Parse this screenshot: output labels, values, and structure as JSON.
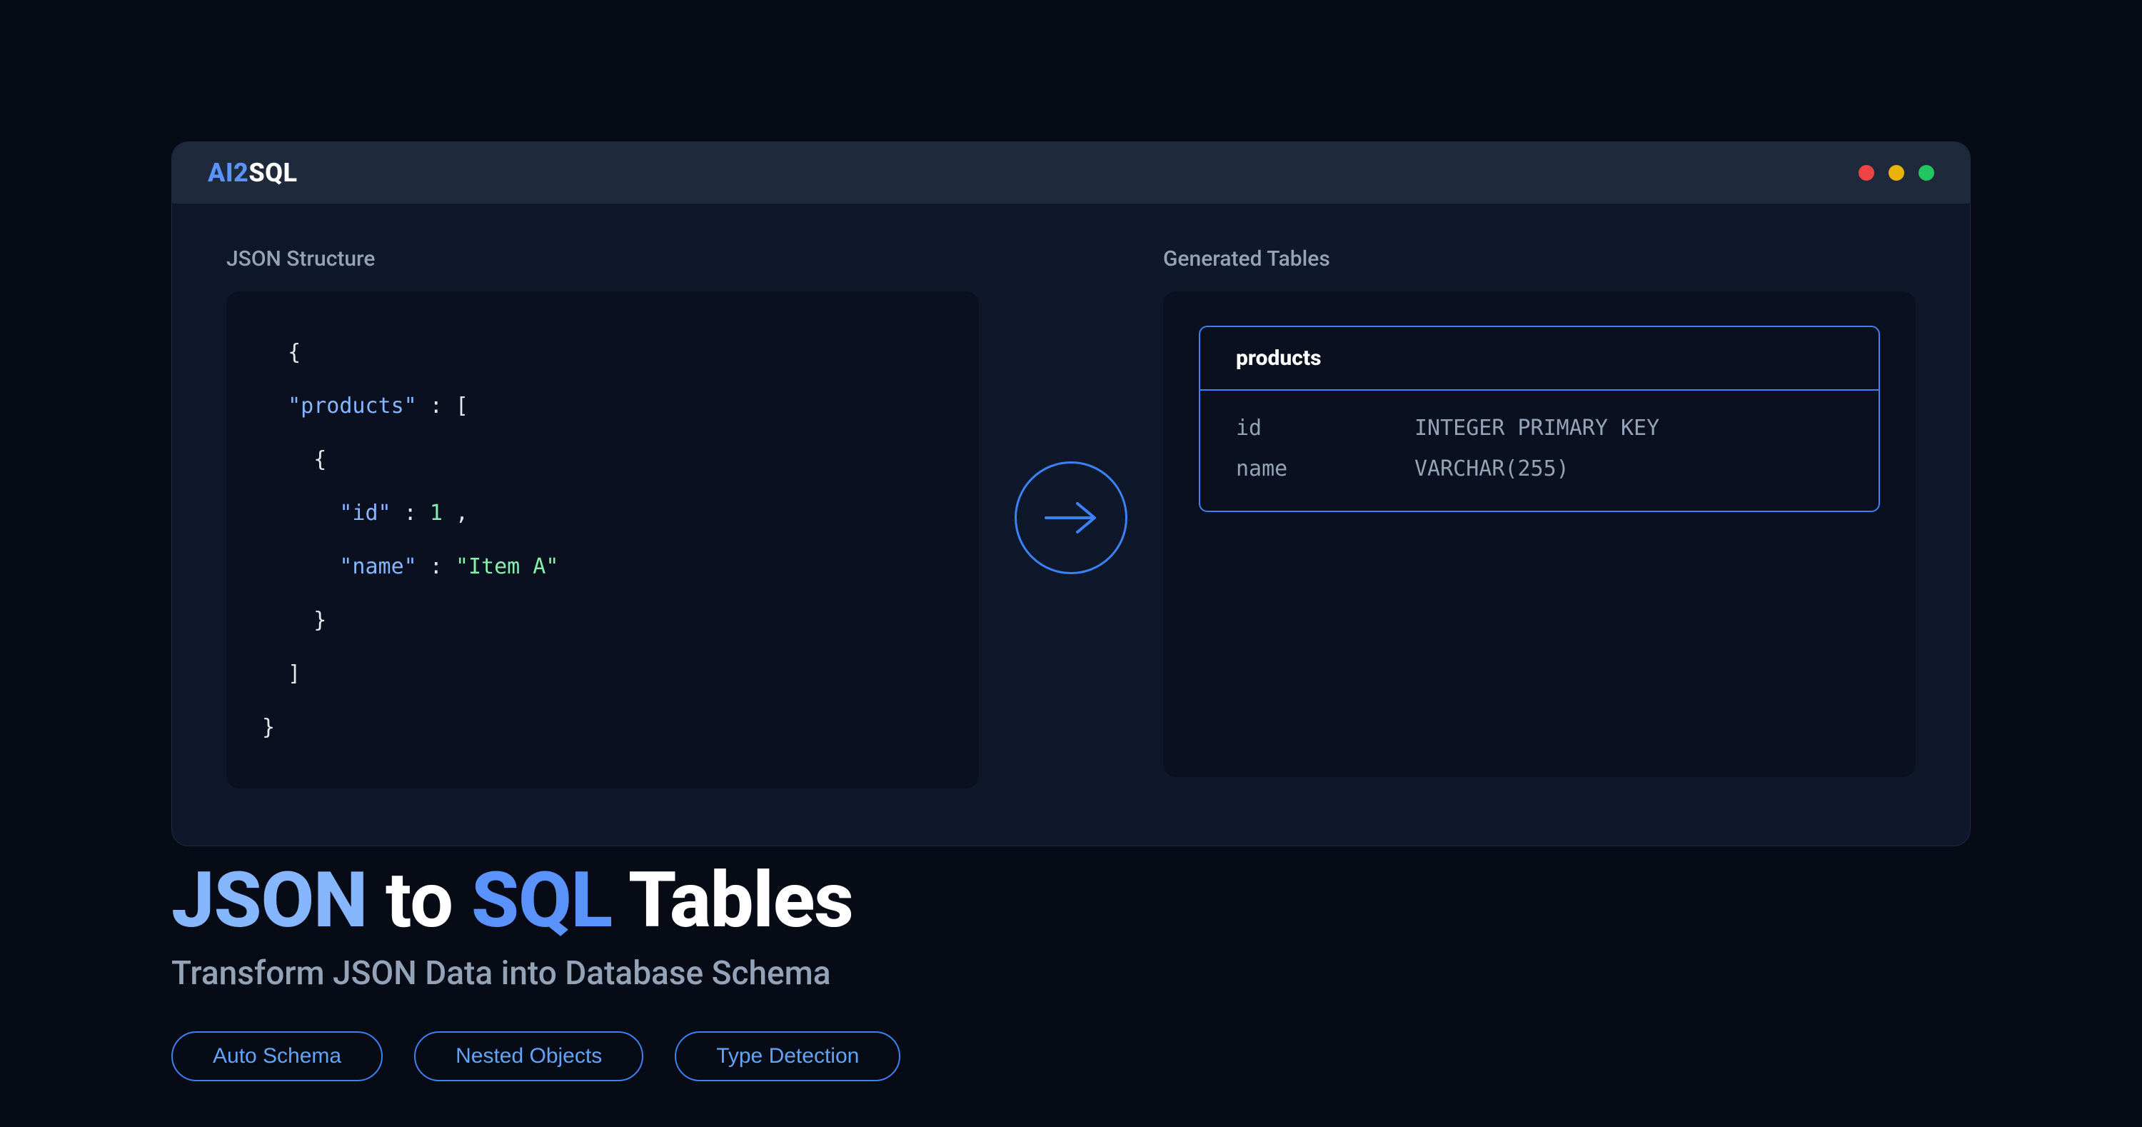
{
  "brand": {
    "part1": "AI2",
    "part2": "SQL"
  },
  "panes": {
    "left_title": "JSON Structure",
    "right_title": "Generated Tables"
  },
  "json_code": {
    "lines": [
      {
        "indent": 0,
        "tokens": [
          {
            "t": "punct",
            "v": "{"
          }
        ]
      },
      {
        "indent": 0,
        "tokens": [
          {
            "t": "key",
            "v": "\"products\""
          },
          {
            "t": "punct",
            "v": " : ["
          }
        ]
      },
      {
        "indent": 2,
        "tokens": [
          {
            "t": "punct",
            "v": "{"
          }
        ]
      },
      {
        "indent": 4,
        "tokens": [
          {
            "t": "key",
            "v": "\"id\""
          },
          {
            "t": "punct",
            "v": " : "
          },
          {
            "t": "num",
            "v": "1"
          },
          {
            "t": "punct",
            "v": " ,"
          }
        ]
      },
      {
        "indent": 4,
        "tokens": [
          {
            "t": "key",
            "v": "\"name\""
          },
          {
            "t": "punct",
            "v": " : "
          },
          {
            "t": "str",
            "v": "\"Item A\""
          }
        ]
      },
      {
        "indent": 2,
        "tokens": [
          {
            "t": "punct",
            "v": "}"
          }
        ]
      },
      {
        "indent": 0,
        "tokens": [
          {
            "t": "punct",
            "v": "]"
          }
        ]
      },
      {
        "indent": -2,
        "tokens": [
          {
            "t": "punct",
            "v": "}"
          }
        ]
      }
    ],
    "outdent": 2
  },
  "table": {
    "name": "products",
    "columns": [
      {
        "name": "id",
        "type": "INTEGER PRIMARY KEY"
      },
      {
        "name": "name",
        "type": "VARCHAR(255)"
      }
    ]
  },
  "hero": {
    "title": {
      "json": "JSON",
      "to": "to",
      "sql": "SQL",
      "tables": "Tables"
    },
    "subtitle": "Transform JSON Data into Database Schema"
  },
  "pills": [
    {
      "label": "Auto Schema"
    },
    {
      "label": "Nested Objects"
    },
    {
      "label": "Type Detection"
    }
  ],
  "colors": {
    "accent": "#3b82f6"
  }
}
